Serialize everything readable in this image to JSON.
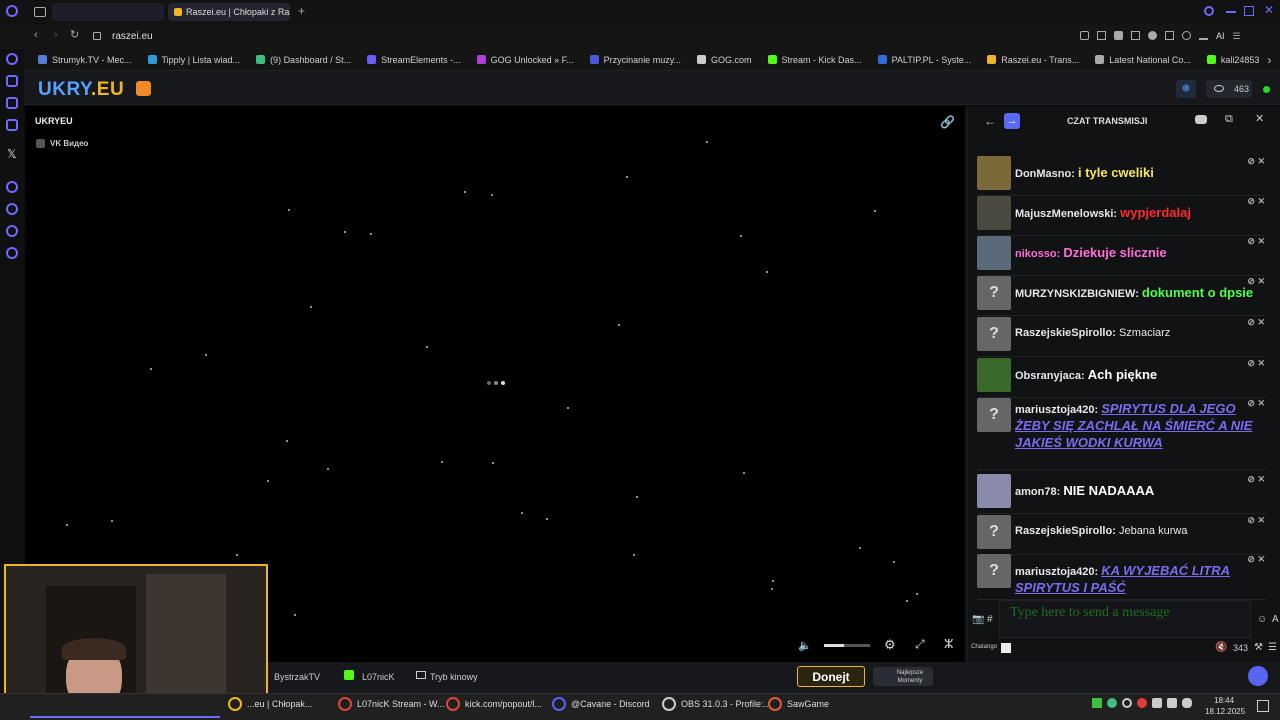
{
  "browser": {
    "active_tab": "Raszei.eu | Chłopaki z Ras",
    "new_tab_icon": "+",
    "address": "raszei.eu",
    "ai_label": "AI",
    "bookmarks": [
      {
        "label": "Strumyk.TV - Mec...",
        "color": "#5a7bd9"
      },
      {
        "label": "Tipply | Lista wiad...",
        "color": "#2f9bd9"
      },
      {
        "label": "(9) Dashboard / St...",
        "color": "#3fbf7f"
      },
      {
        "label": "StreamElements -...",
        "color": "#6b5cf5"
      },
      {
        "label": "GOG Unlocked » F...",
        "color": "#b03fd6"
      },
      {
        "label": "Przycinanie muzy...",
        "color": "#4a5ae0"
      },
      {
        "label": "GOG.com",
        "color": "#cccccc"
      },
      {
        "label": "Stream - Kick Das...",
        "color": "#53fc18"
      },
      {
        "label": "PALTIP.PL - Syste...",
        "color": "#2f6bd9"
      },
      {
        "label": "Raszei.eu - Trans...",
        "color": "#f0b429"
      },
      {
        "label": "Latest National Co...",
        "color": "#aaaaaa"
      },
      {
        "label": "kali24853",
        "color": "#53fc18"
      }
    ]
  },
  "site": {
    "logo_main": "UKRY",
    "logo_suffix": ".EU",
    "viewers": "463",
    "channel_name": "UKRYEU",
    "source_label": "VK Видео"
  },
  "chat": {
    "title": "CZAT TRANSMISJI",
    "messages": [
      {
        "user": "DonMasno",
        "text": "i tyle cweliki",
        "color": "#f5e663",
        "big": true
      },
      {
        "user": "MajuszMenelowski",
        "text": "wypjerdalaj",
        "color": "#ff2b2b",
        "big": true
      },
      {
        "user": "nikosso",
        "text": "Dziekuje slicznie",
        "color": "#ff6fd8",
        "big": true,
        "usercolor": "#ff6fd8"
      },
      {
        "user": "MURZYNSKIZBIGNIEW",
        "text": "dokument o dpsie",
        "color": "#4cff4c",
        "big": true
      },
      {
        "user": "RaszejskieSpirollo",
        "text": "Szmaciarz",
        "color": "#e8e8e8",
        "big": false
      },
      {
        "user": "Obsranyjaca",
        "text": "Ach piękne",
        "color": "#ffffff",
        "big": true
      },
      {
        "user": "mariusztoja420",
        "text": "SPIRYTUS DLA JEGO ŻEBY SIĘ ZACHLAŁ NA ŚMIERĆ A NIE JAKIEŚ WODKI KURWA",
        "color": "#7a6cf0",
        "big": true
      },
      {
        "user": "amon78",
        "text": "NIE NADAAAA",
        "color": "#ffffff",
        "big": true
      },
      {
        "user": "RaszejskieSpirollo",
        "text": "Jebana kurwa",
        "color": "#e8e8e8",
        "big": false
      },
      {
        "user": "mariusztoja420",
        "text": "KA WYJEBAĆ LITRA SPIRYTUS I PAŚĆ",
        "color": "#7a6cf0",
        "big": true
      }
    ],
    "input_placeholder": "Type here to send a message",
    "chatango_label": "Chatango",
    "count": "343"
  },
  "bottombar": {
    "items": [
      "BystrzakTV",
      "L07nicK",
      "Tryb kinowy"
    ],
    "donate": "Donejt",
    "latest": "Najlepsze Momenty"
  },
  "taskbar": {
    "items": [
      {
        "label": "...eu | Chłopak...",
        "color": "#f0b429"
      },
      {
        "label": "L07nicK Stream - W...",
        "color": "#e0443e"
      },
      {
        "label": "kick.com/popout/l...",
        "color": "#e0443e"
      },
      {
        "label": "@Cavane - Discord",
        "color": "#5865f2"
      },
      {
        "label": "OBS 31.0.3 - Profile:...",
        "color": "#cccccc"
      },
      {
        "label": "SawGame",
        "color": "#e05a3e"
      }
    ],
    "time": "18:44",
    "date": "18.12.2025"
  },
  "icons": {
    "back": "arrow-left-icon",
    "forward": "arrow-right-icon",
    "reload": "reload-icon",
    "lock": "lock-icon"
  }
}
